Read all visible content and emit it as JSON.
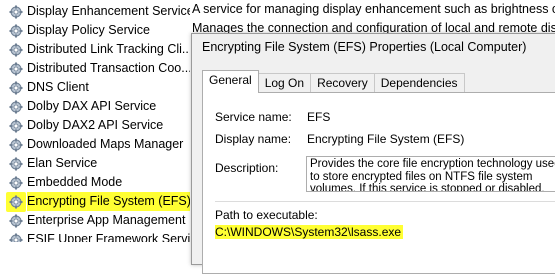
{
  "services": [
    {
      "name": "Display Enhancement Service",
      "selected": false
    },
    {
      "name": "Display Policy Service",
      "selected": false
    },
    {
      "name": "Distributed Link Tracking Cli...",
      "selected": false
    },
    {
      "name": "Distributed Transaction Coo...",
      "selected": false
    },
    {
      "name": "DNS Client",
      "selected": false
    },
    {
      "name": "Dolby DAX API Service",
      "selected": false
    },
    {
      "name": "Dolby DAX2 API Service",
      "selected": false
    },
    {
      "name": "Downloaded Maps Manager",
      "selected": false
    },
    {
      "name": "Elan Service",
      "selected": false
    },
    {
      "name": "Embedded Mode",
      "selected": false
    },
    {
      "name": "Encrypting File System (EFS)",
      "selected": true
    },
    {
      "name": "Enterprise App Management ...",
      "selected": false
    },
    {
      "name": "ESIF Upper Framework Servi...",
      "selected": false
    }
  ],
  "background_description": {
    "line1": "A service for managing display enhancement such as brightness cont",
    "line2": "Manages the connection and configuration of local and remote displ"
  },
  "dialog": {
    "title": "Encrypting File System (EFS) Properties (Local Computer)",
    "tabs": [
      "General",
      "Log On",
      "Recovery",
      "Dependencies"
    ],
    "active_tab": "General",
    "service_name_label": "Service name:",
    "service_name_value": "EFS",
    "display_name_label": "Display name:",
    "display_name_value": "Encrypting File System (EFS)",
    "description_label": "Description:",
    "description_text": "Provides the core file encryption technology used to store encrypted files on NTFS file system volumes. If this service is stopped or disabled, applications will",
    "path_label": "Path to executable:",
    "path_value": "C:\\WINDOWS\\System32\\lsass.exe"
  },
  "colors": {
    "highlight": "#ffff33",
    "dialog_bg": "#f0f0f0",
    "border": "#adadad"
  }
}
